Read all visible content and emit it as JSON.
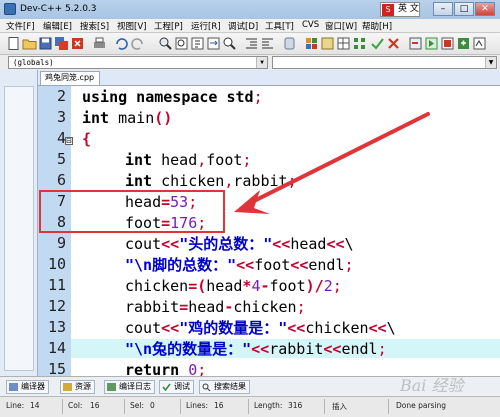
{
  "window": {
    "title": "Dev-C++ 5.2.0.3",
    "ime": {
      "badge": "S",
      "lang": "英 文"
    },
    "controls": {
      "minimize": "–",
      "maximize": "□",
      "close": "✕"
    }
  },
  "menu": [
    "文件[F]",
    "编辑[E]",
    "搜索[S]",
    "视图[V]",
    "工程[P]",
    "运行[R]",
    "调试[D]",
    "工具[T]",
    "CVS",
    "窗口[W]",
    "帮助[H]"
  ],
  "toolbar": {
    "icons": [
      "new-file-icon",
      "open-folder-icon",
      "save-icon",
      "save-all-icon",
      "close-file-icon",
      "print-icon",
      "undo-icon",
      "redo-icon",
      "find-icon",
      "replace-icon",
      "find-next-icon",
      "goto-line-icon",
      "zoom-icon",
      "indent-icon",
      "unindent-icon",
      "bookmark-icon",
      "new-project-icon",
      "class-browser-icon",
      "grid-icon",
      "options-icon",
      "compile-icon",
      "run-icon",
      "check-icon",
      "clear-icon",
      "compile-run-icon",
      "rebuild-icon",
      "debug-icon",
      "project-options-icon"
    ]
  },
  "scope": {
    "selected": "(globals)"
  },
  "editor": {
    "tab": "鸡兔同笼.cpp",
    "line_numbers": [
      "2",
      "3",
      "4",
      "5",
      "6",
      "7",
      "8",
      "9",
      "10",
      "11",
      "12",
      "13",
      "14",
      "15"
    ],
    "fold_marker": "⊟",
    "colors": {
      "keyword": "#000000",
      "operator": "#c8002f",
      "number": "#7a1bb8",
      "string": "#0000cc",
      "current_line": "#d5f6f9",
      "gutter": "#c1d9f1"
    }
  },
  "code": {
    "l2": [
      "using namespace std",
      ";"
    ],
    "l3": [
      "int",
      " main",
      "()"
    ],
    "l4": [
      "{"
    ],
    "l5": [
      "int",
      " head",
      ",",
      "foot",
      ";"
    ],
    "l6": [
      "int",
      " chicken",
      ",",
      "rabbit",
      ";"
    ],
    "l7": [
      "head",
      "=",
      "53",
      ";"
    ],
    "l8": [
      "foot",
      "=",
      "176",
      ";"
    ],
    "l9": [
      "cout",
      "<<",
      "\"头的总数：\"",
      "<<",
      "head",
      "<<",
      "\\"
    ],
    "l10": [
      "\"\\n脚的总数：\"",
      "<<",
      "foot",
      "<<",
      "endl",
      ";"
    ],
    "l11": [
      "chicken",
      "=(",
      "head",
      "*",
      "4",
      "-",
      "foot",
      ")/",
      "2",
      ";"
    ],
    "l12": [
      "rabbit",
      "=",
      "head",
      "-",
      "chicken",
      ";"
    ],
    "l13": [
      "cout",
      "<<",
      "\"鸡的数量是：\"",
      "<<",
      "chicken",
      "<<",
      "\\"
    ],
    "l14": [
      "\"\\n兔的数量是：\"",
      "<<",
      "rabbit",
      "<<",
      "endl",
      ";"
    ],
    "l15": [
      "return",
      " ",
      "0",
      ";"
    ]
  },
  "annotation": {
    "box_color": "#e0343b",
    "arrow_color": "#e0343b"
  },
  "bottom_tabs": [
    "编译器",
    "资源",
    "编译日志",
    "调试",
    "搜索结果"
  ],
  "status": {
    "line_label": "Line:",
    "line_value": "14",
    "col_label": "Col:",
    "col_value": "16",
    "sel_label": "Sel:",
    "sel_value": "0",
    "lines_label": "Lines:",
    "lines_value": "16",
    "length_label": "Length:",
    "length_value": "316",
    "mode": "插入",
    "message": "Done parsing"
  },
  "watermark": "Bai 经验"
}
